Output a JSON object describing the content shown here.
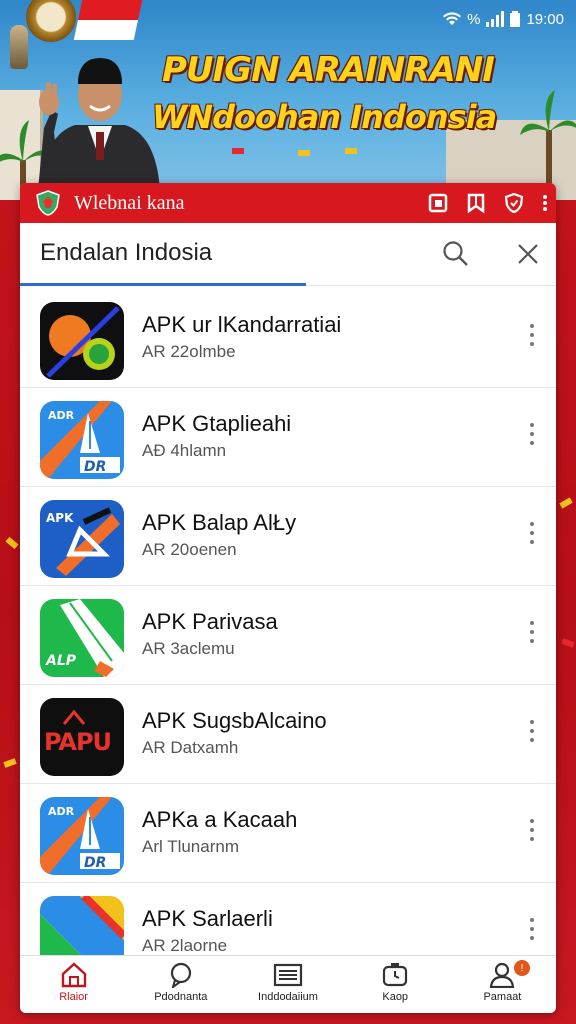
{
  "status_bar": {
    "time": "19:00",
    "battery": "%"
  },
  "banner": {
    "title": "PUIGN ARAINRANI",
    "subtitle": "WNdoohan Indonsia"
  },
  "app": {
    "title": "Wlebnai kana",
    "accent_color": "#d7191f",
    "search": {
      "value": "Endalan Indosia",
      "placeholder": ""
    },
    "items": [
      {
        "name": "APK ur lKandarratiai",
        "sub": "AR 22olmbe",
        "icon": "dark-orange-circle-icon"
      },
      {
        "name": "APK Gtaplieahi",
        "sub": "AÐ 4hlamn",
        "icon": "blue-pen-icon"
      },
      {
        "name": "APK Balap AlŁy",
        "sub": "AR 20oenen",
        "icon": "blue-rocket-icon"
      },
      {
        "name": "APK Parivasa",
        "sub": "AR 3aclemu",
        "icon": "green-brush-icon"
      },
      {
        "name": "APK SugsbAlcaino",
        "sub": "AR Datxamh",
        "icon": "black-papu-icon"
      },
      {
        "name": "APKa a Kacaah",
        "sub": "Arl Tlunarnm",
        "icon": "blue-pen-icon"
      },
      {
        "name": "APK Sarlaerli",
        "sub": "AR 2laorne",
        "icon": "play-colors-icon"
      }
    ],
    "icon_text": {
      "papu": "PAPU",
      "adr": "ADR",
      "dr": "DR",
      "apk": "APK",
      "alp": "ALP"
    },
    "bottom_nav": [
      {
        "label": "Rlaior",
        "icon": "home-icon"
      },
      {
        "label": "Pdodnanta",
        "icon": "chat-icon"
      },
      {
        "label": "Inddodaiium",
        "icon": "list-icon"
      },
      {
        "label": "Kaop",
        "icon": "clock-bag-icon"
      },
      {
        "label": "Pamaat",
        "icon": "profile-icon",
        "badge": "!"
      }
    ]
  }
}
